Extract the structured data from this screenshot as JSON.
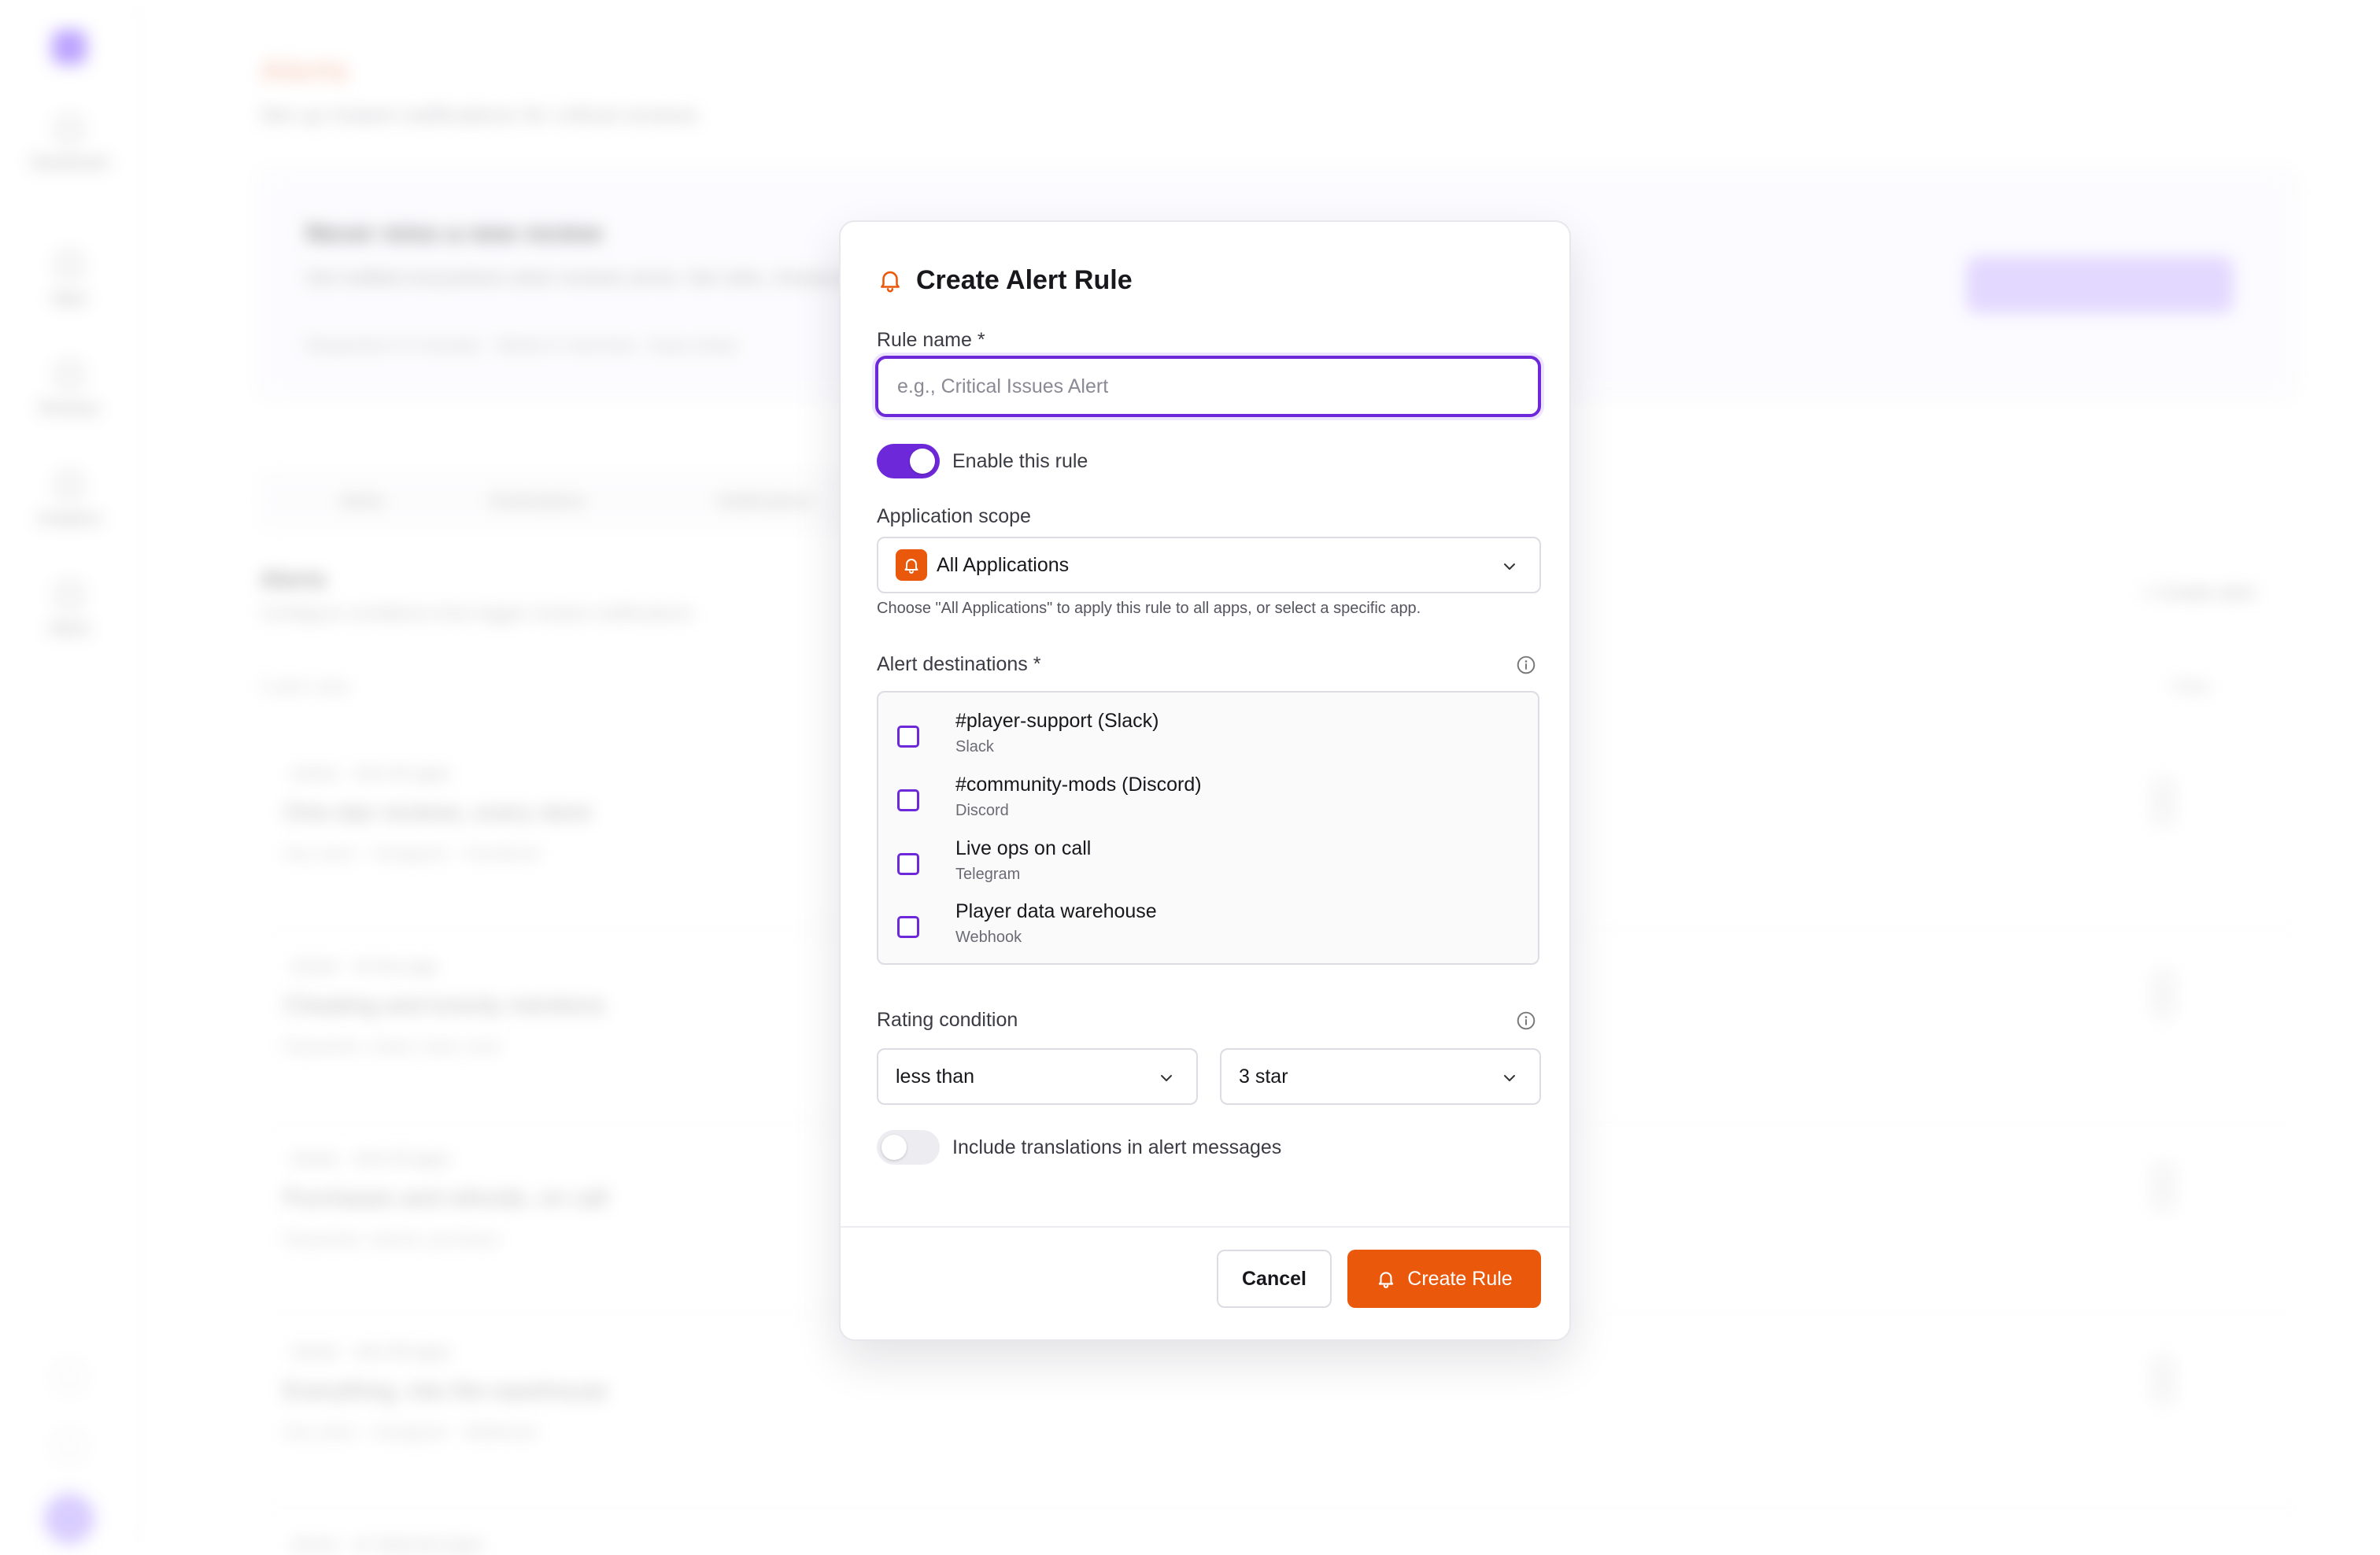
{
  "background": {
    "title": "Alerts",
    "subtitle": "Set up instant notifications for critical reviews",
    "card": {
      "title": "Never miss a new review",
      "text": "Get notified everywhere when reviews arrive. Set rules, choose destinations and get instant notifications on Slack, Discord or Telegram.",
      "meta": "Responds in 5 minutes   ·   Works in real time   ·   Easy setup"
    },
    "tabs": [
      "Alerts",
      "Destinations",
      "Notifications"
    ],
    "section_title": "Alerts",
    "section_sub": "Configure conditions that trigger instant notifications",
    "count": "5 alert rules",
    "create_alert": "+ Create alert",
    "filter": "Filter",
    "nav": [
      "Dashboard",
      "Apps",
      "Reviews",
      "Analytics",
      "Alerts"
    ],
    "rows": [
      {
        "meta": "Active   ·   ★★   All apps",
        "title": "One-star reviews, every store",
        "tags": "Any store   ·   Instagram   ·   Facebook"
      },
      {
        "meta": "Active   ·   ★   Any app",
        "title": "Cheating and toxicity mentions",
        "tags": "Keywords: cheat, hack, toxic"
      },
      {
        "meta": "Active   ·   ★★   All apps",
        "title": "Purchases and refunds, on call",
        "tags": "Keywords: refund, purchase"
      },
      {
        "meta": "Active   ·   ★★   All apps",
        "title": "Everything, into the warehouse",
        "tags": "Any store   ·   Instagram   ·   Webhook"
      },
      {
        "meta": "Active   ·   ★   Selected apps",
        "title": "",
        "tags": ""
      }
    ]
  },
  "modal": {
    "title": "Create Alert Rule",
    "rule_name_label": "Rule name *",
    "rule_name_value": "",
    "rule_name_placeholder": "e.g., Critical Issues Alert",
    "enable_label": "Enable this rule",
    "enable_on": true,
    "scope_label": "Application scope",
    "scope_value": "All Applications",
    "scope_hint": "Choose \"All Applications\" to apply this rule to all apps, or select a specific app.",
    "destinations_label": "Alert destinations *",
    "destinations": [
      {
        "name": "#player-support (Slack)",
        "type": "Slack",
        "checked": false
      },
      {
        "name": "#community-mods (Discord)",
        "type": "Discord",
        "checked": false
      },
      {
        "name": "Live ops on call",
        "type": "Telegram",
        "checked": false
      },
      {
        "name": "Player data warehouse",
        "type": "Webhook",
        "checked": false
      }
    ],
    "rating_label": "Rating condition",
    "rating_operator": "less than",
    "rating_value": "3 star",
    "translations_label": "Include translations in alert messages",
    "translations_on": false,
    "cancel_label": "Cancel",
    "create_label": "Create Rule"
  },
  "colors": {
    "accent": "#6d28d9",
    "brand": "#ea580c"
  }
}
